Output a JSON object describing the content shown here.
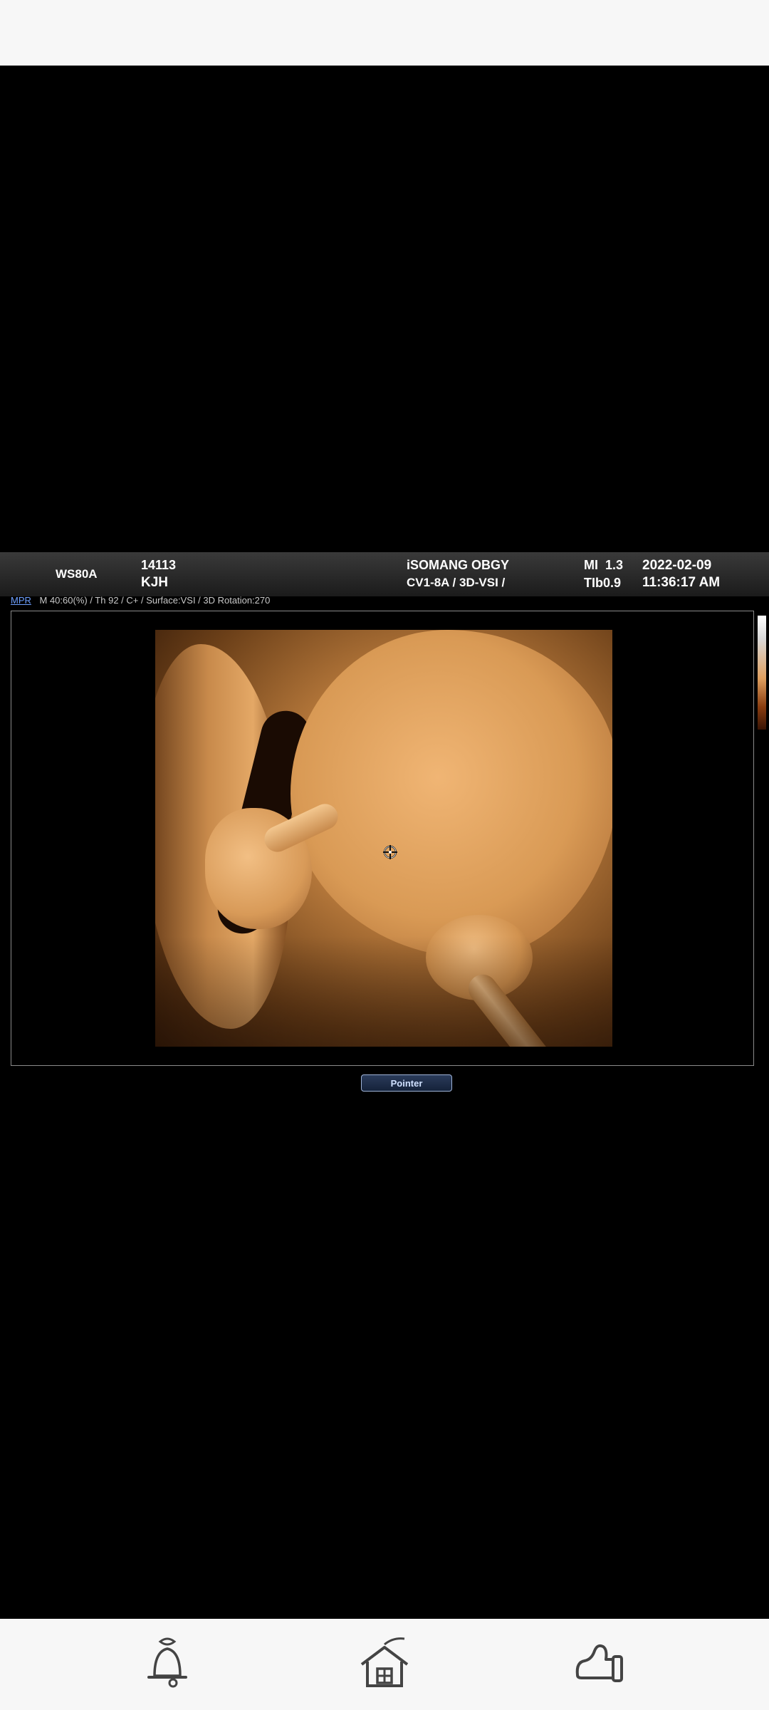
{
  "header": {
    "device": "WS80A",
    "patient_id": "14113",
    "operator": "KJH",
    "institution": "iSOMANG OBGY",
    "probe_mode": "CV1-8A / 3D-VSI /",
    "mi": "MI  1.3",
    "tib": "TIb0.9",
    "date": "2022-02-09",
    "time": "11:36:17 AM"
  },
  "info_line": {
    "mpr_label": "MPR",
    "params": "M 40:60(%) / Th 92 / C+ / Surface:VSI / 3D Rotation:270"
  },
  "pointer_button": {
    "label": "Pointer"
  },
  "bottom_nav": {
    "items": [
      {
        "icon": "bell-icon"
      },
      {
        "icon": "home-icon"
      },
      {
        "icon": "mitten-icon"
      }
    ]
  },
  "colors": {
    "accent_link": "#6ea0ff",
    "render_tone": "#d99a55"
  }
}
